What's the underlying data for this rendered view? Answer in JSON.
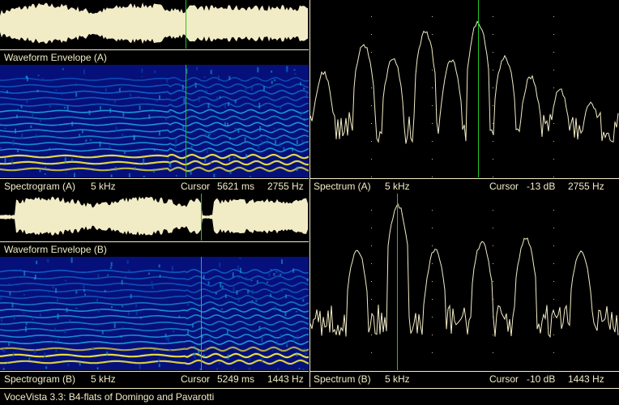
{
  "panels": {
    "waveform_a_label": "Waveform Envelope (A)",
    "waveform_b_label": "Waveform Envelope (B)",
    "spectrogram_a": {
      "name": "Spectrogram (A)",
      "range": "5 kHz",
      "cursor_label": "Cursor",
      "cursor_time": "5621 ms",
      "cursor_freq": "2755 Hz"
    },
    "spectrum_a": {
      "name": "Spectrum (A)",
      "range": "5 kHz",
      "cursor_label": "Cursor",
      "cursor_db": "-13 dB",
      "cursor_freq": "2755 Hz"
    },
    "spectrogram_b": {
      "name": "Spectrogram (B)",
      "range": "5 kHz",
      "cursor_label": "Cursor",
      "cursor_time": "5249 ms",
      "cursor_freq": "1443 Hz"
    },
    "spectrum_b": {
      "name": "Spectrum (B)",
      "range": "5 kHz",
      "cursor_label": "Cursor",
      "cursor_db": "-10 dB",
      "cursor_freq": "1443 Hz"
    }
  },
  "status": "VoceVista 3.3: B4-flats of Domingo and Pavarotti",
  "colors": {
    "background": "#000000",
    "trace": "#f2ecc6",
    "cursor": "#1ec81e",
    "spectrogram_low": "#06107a",
    "spectrogram_mid": "#1aa0e0",
    "spectrogram_high": "#e8e040"
  }
}
